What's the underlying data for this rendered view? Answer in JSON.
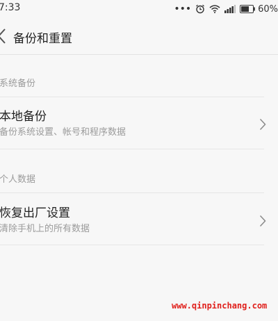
{
  "status_bar": {
    "time": "7:33",
    "battery_percent": "60%",
    "icons": [
      "more-dots-icon",
      "alarm-icon",
      "wifi-icon",
      "signal-icon",
      "battery-icon"
    ]
  },
  "header": {
    "title": "备份和重置",
    "back_icon": "back-chevron-icon"
  },
  "sections": [
    {
      "header": "系统备份",
      "items": [
        {
          "title": "本地备份",
          "subtitle": "备份系统设置、帐号和程序数据",
          "icon": "chevron-right-icon"
        }
      ]
    },
    {
      "header": "个人数据",
      "items": [
        {
          "title": "恢复出厂设置",
          "subtitle": "清除手机上的所有数据",
          "icon": "chevron-right-icon"
        }
      ]
    }
  ],
  "watermark": "www.qinpinchang.com",
  "colors": {
    "background": "#f7f7f7",
    "primary_text": "#222222",
    "secondary_text": "#9b9b9b",
    "divider": "#e6e6e6",
    "watermark": "#e0201c"
  }
}
